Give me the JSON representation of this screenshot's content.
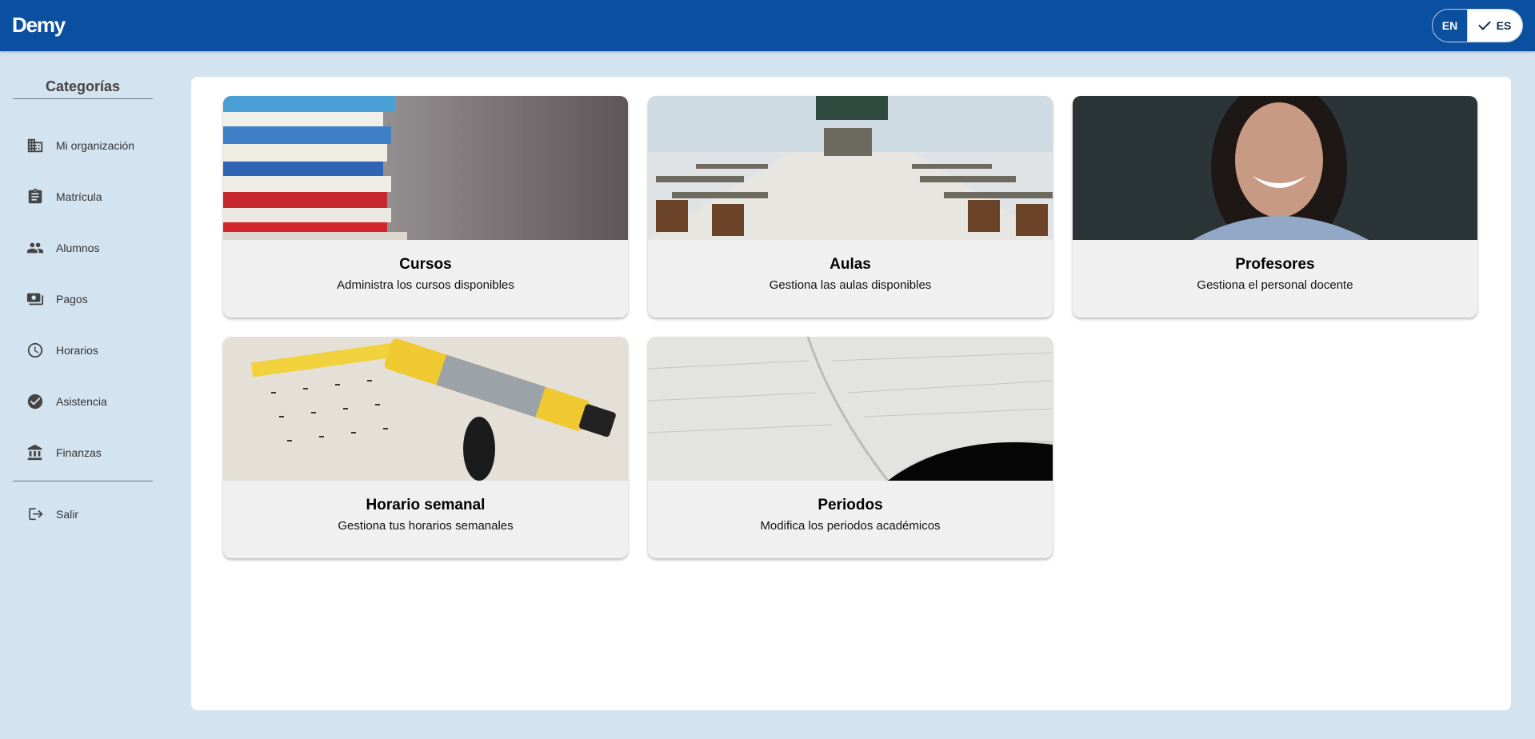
{
  "app": {
    "brand": "Demy"
  },
  "language": {
    "en": "EN",
    "es": "ES",
    "selected": "ES"
  },
  "sidebar": {
    "title": "Categorías",
    "items": [
      {
        "label": "Mi organización",
        "icon": "building-icon"
      },
      {
        "label": "Matrícula",
        "icon": "clipboard-icon"
      },
      {
        "label": "Alumnos",
        "icon": "people-icon"
      },
      {
        "label": "Pagos",
        "icon": "payments-icon"
      },
      {
        "label": "Horarios",
        "icon": "clock-icon"
      },
      {
        "label": "Asistencia",
        "icon": "check-circle-icon"
      },
      {
        "label": "Finanzas",
        "icon": "bank-icon"
      }
    ],
    "logout": {
      "label": "Salir",
      "icon": "logout-icon"
    }
  },
  "cards": [
    {
      "title": "Cursos",
      "description": "Administra los cursos disponibles"
    },
    {
      "title": "Aulas",
      "description": "Gestiona las aulas disponibles"
    },
    {
      "title": "Profesores",
      "description": "Gestiona el personal docente"
    },
    {
      "title": "Horario semanal",
      "description": "Gestiona tus horarios semanales"
    },
    {
      "title": "Periodos",
      "description": "Modifica los periodos académicos"
    }
  ],
  "colors": {
    "primary": "#0b4fa0",
    "background": "#d3e3f0"
  }
}
